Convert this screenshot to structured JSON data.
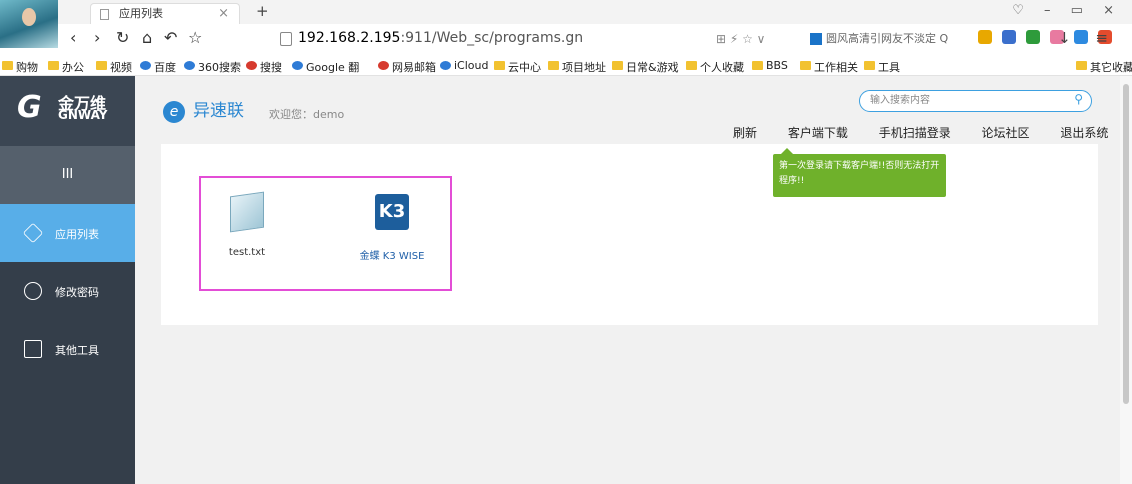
{
  "browser": {
    "tab_title": "应用列表",
    "tab_close": "×",
    "new_tab": "+",
    "window_controls": "♡ – ▭ ×",
    "url_host": "192.168.2.195",
    "url_rest": ":911/Web_sc/programs.gn",
    "url_right": "⊞ ⚡ ☆ ∨",
    "search_text": "圆风高清引网友不淡定 Q",
    "nav_right": "↓ ≡",
    "bookmarks": [
      "购物",
      "办公",
      "视频",
      "百度",
      "360搜索",
      "搜搜",
      "Google 翻",
      "网易邮箱",
      "iCloud",
      "云中心",
      "项目地址",
      "日常&游戏",
      "个人收藏",
      "BBS",
      "工作相关",
      "工具",
      "其它收藏"
    ]
  },
  "sidebar": {
    "logo_mark": "G",
    "logo_cn": "金万维",
    "logo_en": "GNWAY",
    "toggle": "III",
    "items": [
      {
        "label": "应用列表"
      },
      {
        "label": "修改密码"
      },
      {
        "label": "其他工具"
      }
    ]
  },
  "header": {
    "brand_mark": "e",
    "brand": "异速联",
    "welcome": "欢迎您：demo",
    "search_placeholder": "输入搜索内容",
    "links": [
      "刷新",
      "客户端下载",
      "手机扫描登录",
      "论坛社区",
      "退出系统"
    ]
  },
  "apps": [
    {
      "name": "test.txt"
    },
    {
      "name": "金蝶 K3 WISE",
      "icon_text": "K3"
    }
  ],
  "tooltip": "第一次登录请下载客户端!!否则无法打开程序!!",
  "colors": {
    "sidebar": "#343e4a",
    "active": "#58aee8",
    "brand": "#2b87d1",
    "tooltip": "#6fb12b",
    "highlight": "#e34dd6"
  }
}
